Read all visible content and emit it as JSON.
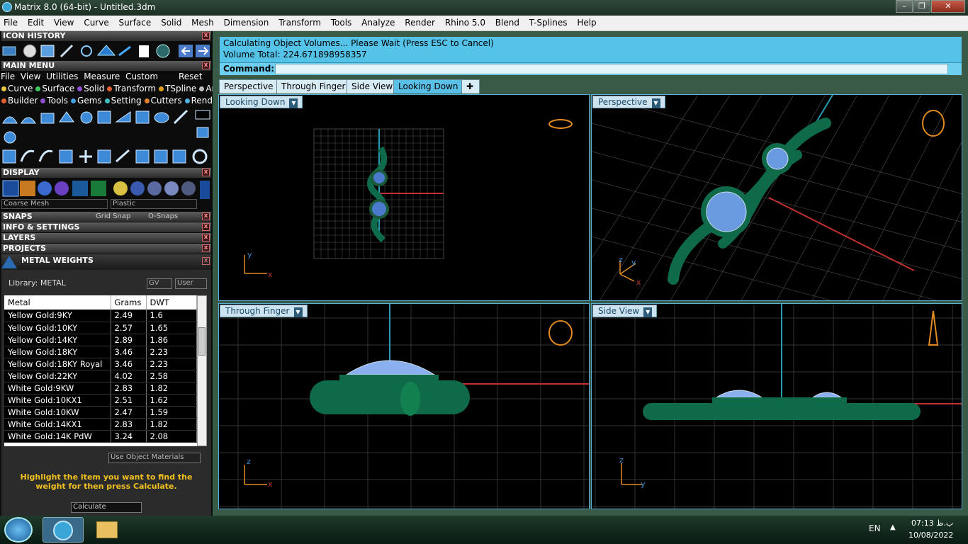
{
  "window": {
    "title": "Matrix 8.0 (64-bit) - Untitled.3dm"
  },
  "menu": [
    "File",
    "Edit",
    "View",
    "Curve",
    "Surface",
    "Solid",
    "Mesh",
    "Dimension",
    "Transform",
    "Tools",
    "Analyze",
    "Render",
    "Rhino 5.0",
    "Blend",
    "T-Splines",
    "Help"
  ],
  "panels": {
    "icon_history": "ICON HISTORY",
    "main_menu": "MAIN MENU",
    "display": "DISPLAY",
    "snaps": "SNAPS",
    "grid_snap": "Grid Snap",
    "o_snaps": "O-Snaps",
    "info_settings": "INFO & SETTINGS",
    "layers": "LAYERS",
    "projects": "PROJECTS",
    "metal_weights": "METAL WEIGHTS"
  },
  "main_menu_row1": [
    "File",
    "View",
    "Utilities",
    "Measure",
    "Custom"
  ],
  "reset": "Reset",
  "main_menu_row2": [
    {
      "label": "Curve",
      "color": "#e8c840"
    },
    {
      "label": "Surface",
      "color": "#40c860"
    },
    {
      "label": "Solid",
      "color": "#9050d0"
    },
    {
      "label": "Transform",
      "color": "#e06030"
    },
    {
      "label": "TSpline",
      "color": "#e0a020"
    },
    {
      "label": "Art",
      "color": "#c0c0c0"
    }
  ],
  "main_menu_row3": [
    {
      "label": "Builder",
      "color": "#e06030"
    },
    {
      "label": "Tools",
      "color": "#9050d0"
    },
    {
      "label": "Gems",
      "color": "#40a0e0"
    },
    {
      "label": "Setting",
      "color": "#40c0c0"
    },
    {
      "label": "Cutters",
      "color": "#e08030"
    },
    {
      "label": "Render",
      "color": "#50b0e0"
    }
  ],
  "display": {
    "mesh": "Coarse Mesh",
    "material": "Plastic"
  },
  "metal": {
    "library": "Library: METAL",
    "gv": "GV",
    "user": "User",
    "columns": [
      "Metal",
      "Grams",
      "DWT"
    ],
    "rows": [
      [
        "Yellow Gold:9KY",
        "2.49",
        "1.6"
      ],
      [
        "Yellow Gold:10KY",
        "2.57",
        "1.65"
      ],
      [
        "Yellow Gold:14KY",
        "2.89",
        "1.86"
      ],
      [
        "Yellow Gold:18KY",
        "3.46",
        "2.23"
      ],
      [
        "Yellow Gold:18KY Royal",
        "3.46",
        "2.23"
      ],
      [
        "Yellow Gold:22KY",
        "4.02",
        "2.58"
      ],
      [
        "White Gold:9KW",
        "2.83",
        "1.82"
      ],
      [
        "White Gold:10KX1",
        "2.51",
        "1.62"
      ],
      [
        "White Gold:10KW",
        "2.47",
        "1.59"
      ],
      [
        "White Gold:14KX1",
        "2.83",
        "1.82"
      ],
      [
        "White Gold:14K PdW",
        "3.24",
        "2.08"
      ]
    ],
    "use_object_materials": "Use Object Materials",
    "hint": "Highlight the item you want to find the weight for then press Calculate.",
    "calculate": "Calculate"
  },
  "command": {
    "line1": "Calculating Object Volumes... Please Wait (Press ESC to Cancel)",
    "line2": "Volume Total: 224.671898958357",
    "prompt": "Command:"
  },
  "tabs": [
    "Perspective",
    "Through Finger",
    "Side View",
    "Looking Down"
  ],
  "viewports": {
    "top_left": "Looking Down",
    "top_right": "Perspective",
    "bottom_left": "Through Finger",
    "bottom_right": "Side View"
  },
  "axes": {
    "x": "x",
    "y": "y",
    "z": "z"
  },
  "taskbar": {
    "lang": "EN",
    "time": "07:13 ب.ظ",
    "date": "10/08/2022"
  }
}
